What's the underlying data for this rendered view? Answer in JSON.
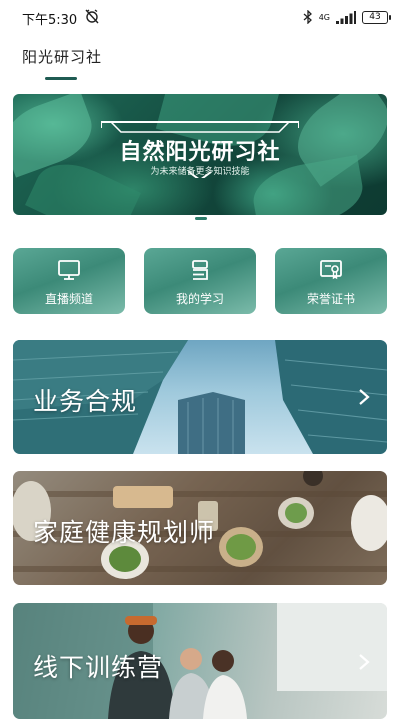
{
  "status_bar": {
    "time": "下午5:30",
    "network": "4G",
    "battery": "43"
  },
  "header": {
    "tab_label": "阳光研习社"
  },
  "banner": {
    "title": "自然阳光研习社",
    "subtitle": "为未来储备更多知识技能"
  },
  "quick_actions": [
    {
      "label": "直播频道",
      "icon": "monitor-icon"
    },
    {
      "label": "我的学习",
      "icon": "book-stack-icon"
    },
    {
      "label": "荣誉证书",
      "icon": "certificate-icon"
    }
  ],
  "categories": [
    {
      "title": "业务合规",
      "icon": "chevron-right-icon"
    },
    {
      "title": "家庭健康规划师",
      "icon": "chevron-right-icon"
    },
    {
      "title": "线下训练营",
      "icon": "chevron-right-icon"
    }
  ],
  "colors": {
    "accent": "#1f5b52",
    "quick_button": "#4e9a88",
    "banner_green": "#1f6b58"
  }
}
